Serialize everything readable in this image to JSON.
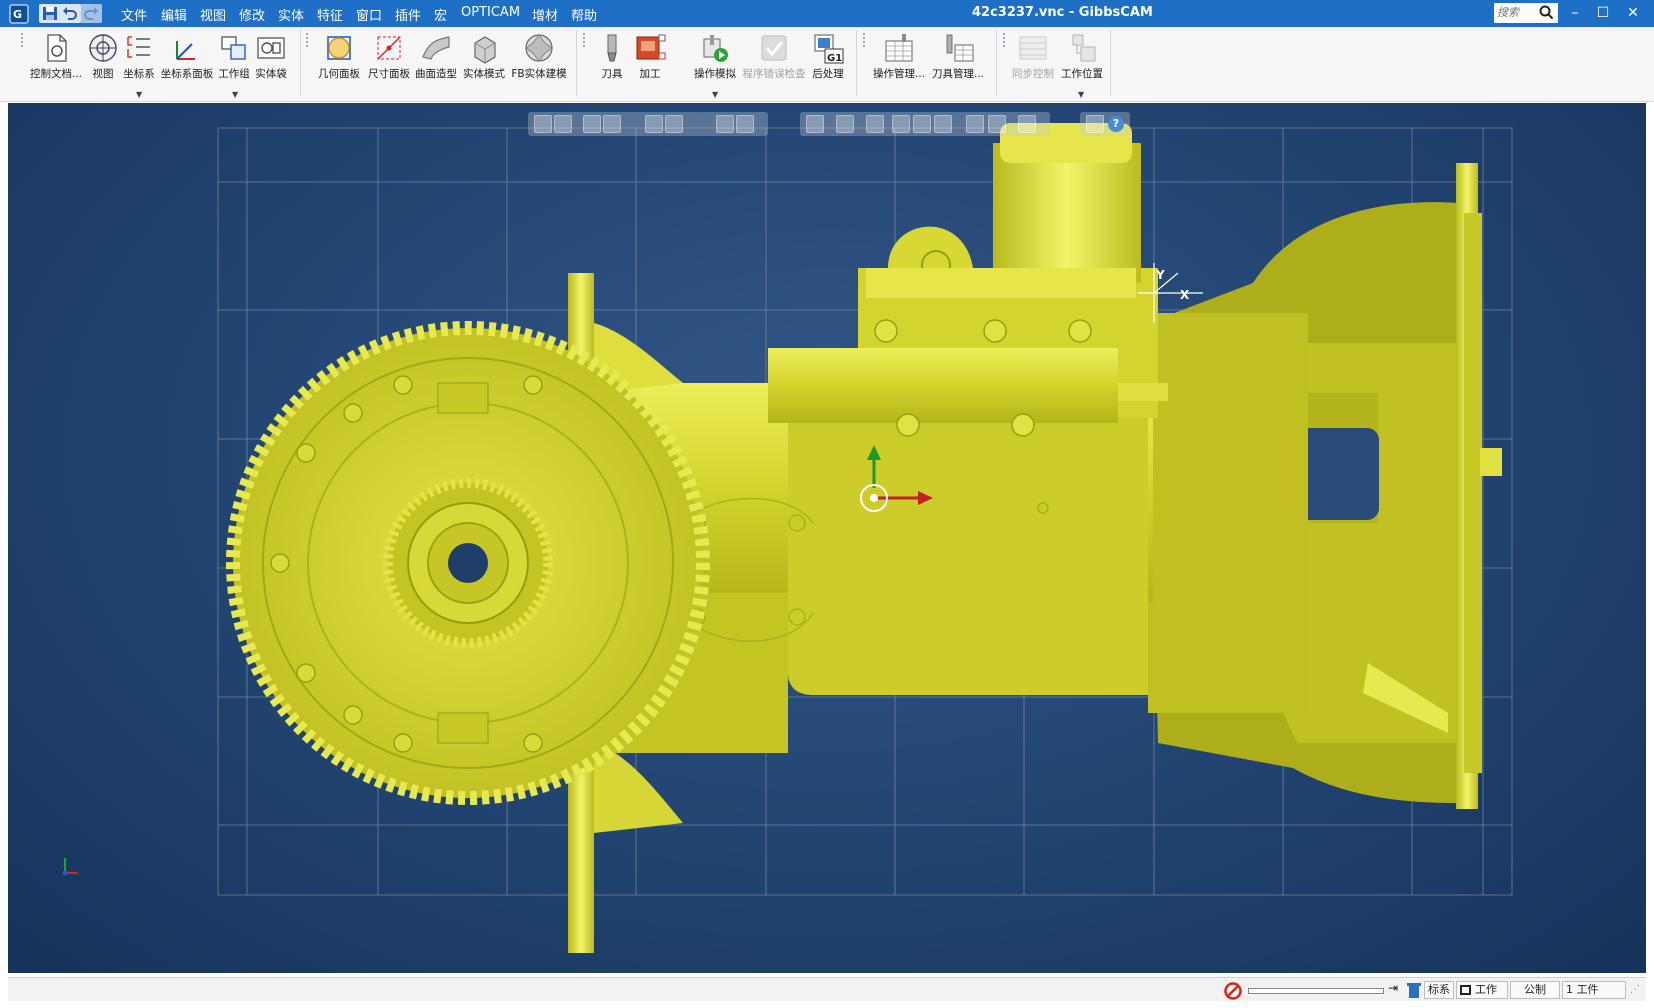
{
  "window": {
    "title": "42c3237.vnc - GibbsCAM",
    "app_logo": "G",
    "search_placeholder": "搜索",
    "controls": {
      "minimize": "–",
      "maximize": "☐",
      "close": "✕"
    }
  },
  "menu": [
    "文件",
    "编辑",
    "视图",
    "修改",
    "实体",
    "特征",
    "窗口",
    "插件",
    "宏",
    "OPTICAM",
    "增材",
    "帮助"
  ],
  "ribbon": {
    "tools": [
      {
        "label": "控制文档...",
        "icon": "document-icon"
      },
      {
        "label": "视图",
        "icon": "view-cube-icon"
      },
      {
        "label": "坐标系",
        "icon": "coordinate-system-icon"
      },
      {
        "label": "坐标系面板",
        "icon": "csys-panel-icon"
      },
      {
        "label": "工作组",
        "icon": "workgroup-icon"
      },
      {
        "label": "实体袋",
        "icon": "solids-bag-icon"
      },
      {
        "label": "几何面板",
        "icon": "geometry-panel-icon"
      },
      {
        "label": "尺寸面板",
        "icon": "dimension-panel-icon"
      },
      {
        "label": "曲面造型",
        "icon": "surface-icon"
      },
      {
        "label": "实体模式",
        "icon": "solid-mode-icon"
      },
      {
        "label": "FB实体建模",
        "icon": "fb-solid-icon"
      },
      {
        "label": "刀具",
        "icon": "tool-icon"
      },
      {
        "label": "加工",
        "icon": "machining-icon"
      },
      {
        "label": "操作模拟",
        "icon": "simulate-icon"
      },
      {
        "label": "程序错误检查",
        "icon": "check-icon"
      },
      {
        "label": "后处理",
        "icon": "post-process-icon",
        "badge": "G1"
      },
      {
        "label": "操作管理...",
        "icon": "operation-manager-icon"
      },
      {
        "label": "刀具管理...",
        "icon": "tool-manager-icon"
      },
      {
        "label": "同步控制",
        "icon": "sync-icon"
      },
      {
        "label": "工作位置",
        "icon": "work-position-icon"
      }
    ]
  },
  "viewport": {
    "axis_labels": {
      "x": "X",
      "y": "Y"
    },
    "model_color": "#d6d62a",
    "background_color": "#244775",
    "grid": true,
    "help_button": "?"
  },
  "statusbar": {
    "segments": [
      "标系",
      "工作",
      "公制",
      "1 工件"
    ]
  }
}
